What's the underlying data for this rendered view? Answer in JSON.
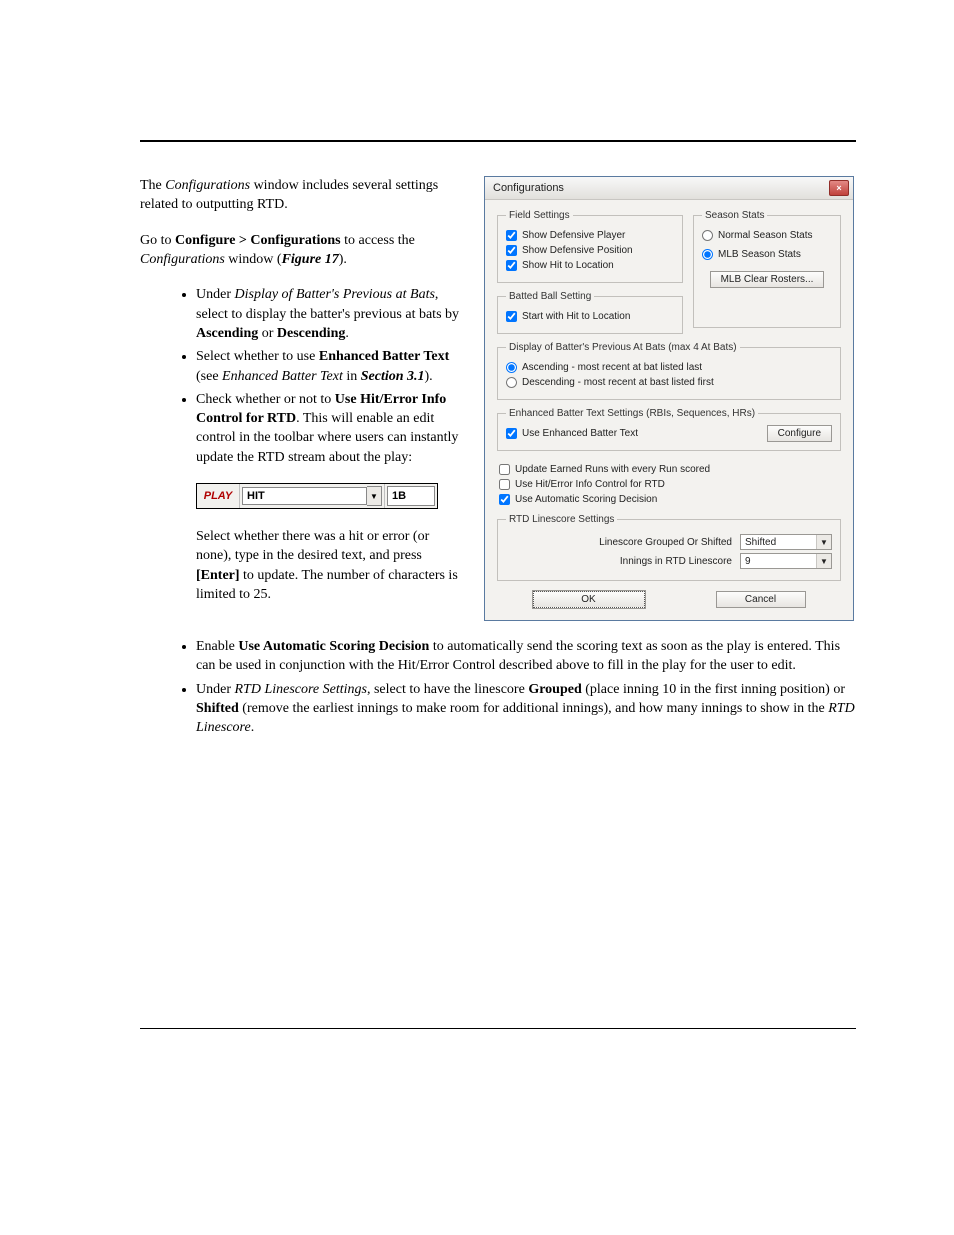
{
  "doc": {
    "intro_p1_a": "The ",
    "intro_p1_b": "Configurations",
    "intro_p1_c": " window includes several settings related to outputting RTD.",
    "intro_p2_a": "Go to ",
    "intro_p2_b": "Configure > Configurations",
    "intro_p2_c": " to access the ",
    "intro_p2_d": "Configurations",
    "intro_p2_e": " window (",
    "intro_p2_f": "Figure 17",
    "intro_p2_g": ").",
    "b1_a": "Under ",
    "b1_b": "Display of Batter's Previous at Bats",
    "b1_c": ", select to display the batter's previous at bats by ",
    "b1_d": "Ascending",
    "b1_e": " or ",
    "b1_f": "Descending",
    "b1_g": ".",
    "b2_a": "Select whether to use ",
    "b2_b": "Enhanced Batter Text",
    "b2_c": " (see ",
    "b2_d": "Enhanced Batter Text",
    "b2_e": " in ",
    "b2_f": "Section 3.1",
    "b2_g": ").",
    "b3_a": "Check whether or not to ",
    "b3_b": "Use Hit/Error Info Control for RTD",
    "b3_c": ". This will enable an edit control in the toolbar where users can instantly update the RTD stream about the play:",
    "after_a": "Select whether there was a hit or error (or none), type in the desired text, and press ",
    "after_b": "[Enter]",
    "after_c": " to update. The number of characters is limited to 25.",
    "b4_a": "Enable ",
    "b4_b": "Use Automatic Scoring Decision",
    "b4_c": " to automatically send the scoring text as soon as the play is entered. This can be used in conjunction with the Hit/Error Control described above to fill in the play for the user to edit.",
    "b5_a": "Under ",
    "b5_b": "RTD Linescore Settings",
    "b5_c": ", select to have the linescore ",
    "b5_d": "Grouped",
    "b5_e": " (place inning 10 in the first inning position) or ",
    "b5_f": "Shifted",
    "b5_g": " (remove the earliest innings to make room for additional innings), and how many innings to show in the ",
    "b5_h": "RTD Linescore",
    "b5_i": "."
  },
  "toolbar": {
    "play": "PLAY",
    "hit": "HIT",
    "oneb": "1B"
  },
  "cfg": {
    "title": "Configurations",
    "close": "×",
    "field_settings": "Field Settings",
    "show_def_player": "Show Defensive Player",
    "show_def_pos": "Show Defensive Position",
    "show_hit_loc": "Show Hit to Location",
    "batted_ball": "Batted Ball Setting",
    "start_hit_loc": "Start with Hit to Location",
    "season_stats": "Season Stats",
    "normal_stats": "Normal Season Stats",
    "mlb_stats": "MLB Season Stats",
    "mlb_clear": "MLB Clear Rosters...",
    "disp_batters": "Display of Batter's Previous At Bats (max 4 At Bats)",
    "asc": "Ascending - most recent at bat listed last",
    "desc": "Descending - most recent at bast listed first",
    "enh_settings": "Enhanced Batter Text Settings (RBIs, Sequences, HRs)",
    "use_enh": "Use Enhanced Batter Text",
    "configure": "Configure",
    "upd_earned": "Update Earned Runs with every Run scored",
    "use_hiterr": "Use Hit/Error Info Control for RTD",
    "use_auto": "Use Automatic Scoring Decision",
    "rtd_settings": "RTD Linescore Settings",
    "grouped_shifted": "Linescore Grouped Or Shifted",
    "shifted": "Shifted",
    "innings_lbl": "Innings in RTD Linescore",
    "innings_val": "9",
    "ok": "OK",
    "cancel": "Cancel"
  }
}
